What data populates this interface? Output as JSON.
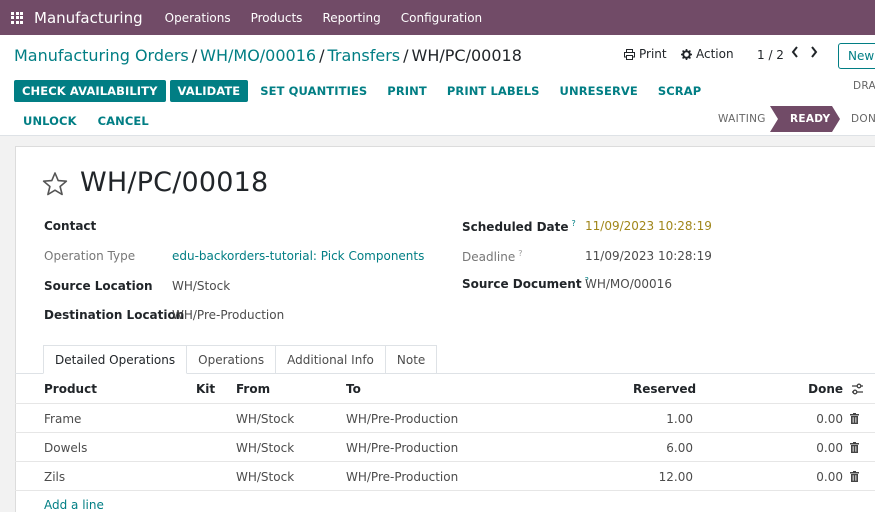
{
  "topbar": {
    "app_name": "Manufacturing",
    "menu": [
      "Operations",
      "Products",
      "Reporting",
      "Configuration"
    ]
  },
  "breadcrumb": {
    "items": [
      "Manufacturing Orders",
      "WH/MO/00016",
      "Transfers"
    ],
    "current": "WH/PC/00018",
    "separator": "/"
  },
  "toolbar": {
    "print_label": "Print",
    "action_label": "Action",
    "pager": "1 / 2",
    "new_label": "New"
  },
  "buttons": {
    "check_availability": "CHECK AVAILABILITY",
    "validate": "VALIDATE",
    "set_quantities": "SET QUANTITIES",
    "print": "PRINT",
    "print_labels": "PRINT LABELS",
    "unreserve": "UNRESERVE",
    "scrap": "SCRAP",
    "unlock": "UNLOCK",
    "cancel": "CANCEL"
  },
  "statusbar": {
    "draft": "DRA",
    "waiting": "WAITING",
    "ready": "READY",
    "done": "DON",
    "current": "READY"
  },
  "record": {
    "title": "WH/PC/00018",
    "fields_left": [
      {
        "label": "Contact",
        "value": ""
      },
      {
        "label": "Operation Type",
        "value": "edu-backorders-tutorial: Pick Components"
      },
      {
        "label": "Source Location",
        "value": "WH/Stock"
      },
      {
        "label": "Destination Location",
        "value": "WH/Pre-Production"
      }
    ],
    "fields_right": [
      {
        "label": "Scheduled Date",
        "help": "?",
        "value": "11/09/2023 10:28:19"
      },
      {
        "label": "Deadline",
        "help": "?",
        "value": "11/09/2023 10:28:19"
      },
      {
        "label": "Source Document",
        "help": "?",
        "value": "WH/MO/00016"
      }
    ]
  },
  "tabs": [
    "Detailed Operations",
    "Operations",
    "Additional Info",
    "Note"
  ],
  "table": {
    "columns": [
      "Product",
      "Kit",
      "From",
      "To",
      "Reserved",
      "Done"
    ],
    "rows": [
      {
        "product": "Frame",
        "kit": "",
        "from": "WH/Stock",
        "to": "WH/Pre-Production",
        "reserved": "1.00",
        "done": "0.00"
      },
      {
        "product": "Dowels",
        "kit": "",
        "from": "WH/Stock",
        "to": "WH/Pre-Production",
        "reserved": "6.00",
        "done": "0.00"
      },
      {
        "product": "Zils",
        "kit": "",
        "from": "WH/Stock",
        "to": "WH/Pre-Production",
        "reserved": "12.00",
        "done": "0.00"
      }
    ],
    "add_line": "Add a line"
  },
  "colors": {
    "brand": "#714b67",
    "accent": "#017e84",
    "warning_date": "#a0861a"
  },
  "icons": [
    "apps-grid-icon",
    "print-icon",
    "gear-icon",
    "chevron-left-icon",
    "chevron-right-icon",
    "star-icon",
    "help-icon",
    "column-settings-icon",
    "trash-icon"
  ]
}
